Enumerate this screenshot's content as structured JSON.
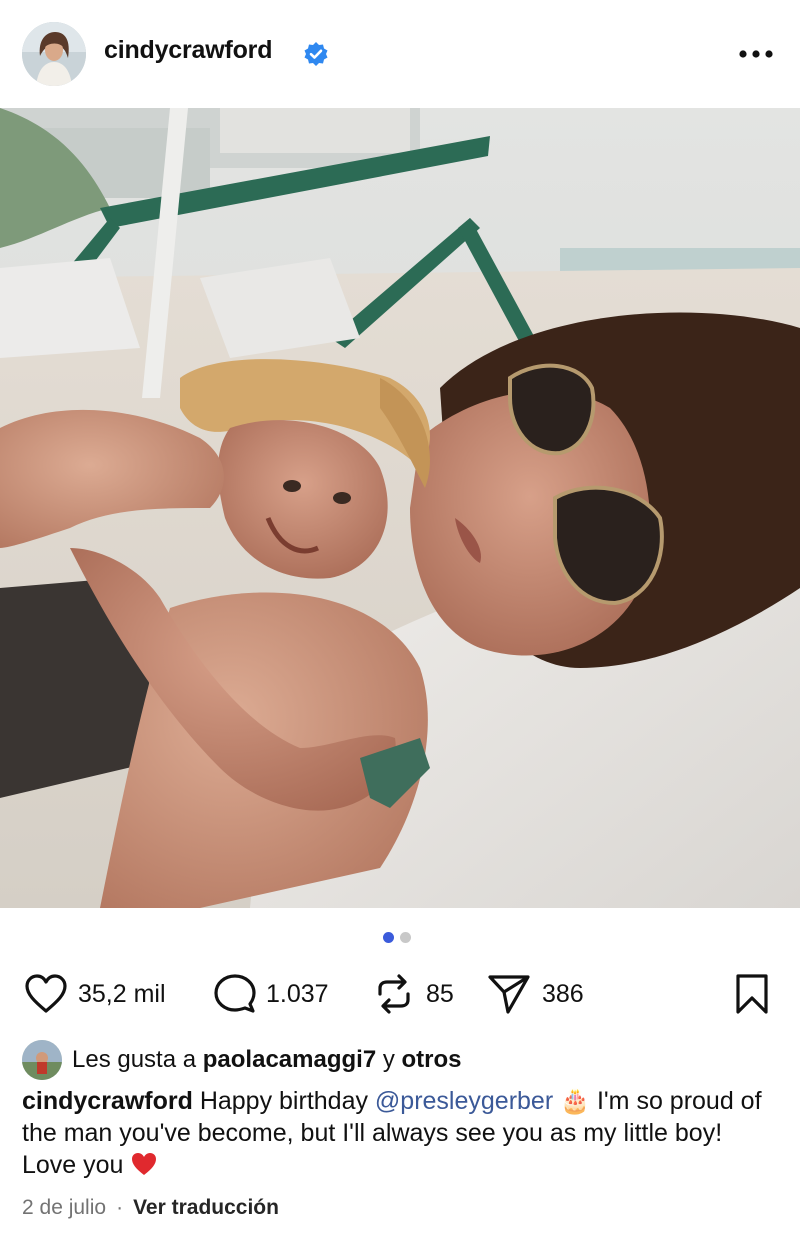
{
  "post": {
    "username": "cindycrawford",
    "verified": true,
    "more_icon": "more-horizontal-icon"
  },
  "media": {
    "page_count": 2,
    "current_page": 1,
    "dot_active_color": "#3b5bdb"
  },
  "actions": {
    "likes": "35,2 mil",
    "comments": "1.037",
    "reposts": "85",
    "shares": "386",
    "icons": [
      "heart-icon",
      "comment-icon",
      "repost-icon",
      "share-icon",
      "bookmark-icon"
    ]
  },
  "liked_by": {
    "prefix": "Les gusta a ",
    "user": "paolacamaggi7",
    "middle": " y ",
    "others": "otros"
  },
  "caption": {
    "user": "cindycrawford",
    "text_1": " Happy birthday ",
    "mention": "@presleygerber",
    "emoji_cake": "🎂",
    "text_2": " I'm so proud of the man you've become, but I'll always see you as my little boy! Love you ",
    "emoji_heart": "❤️"
  },
  "meta": {
    "date": "2 de julio",
    "separator": "·",
    "translate": "Ver traducción"
  }
}
